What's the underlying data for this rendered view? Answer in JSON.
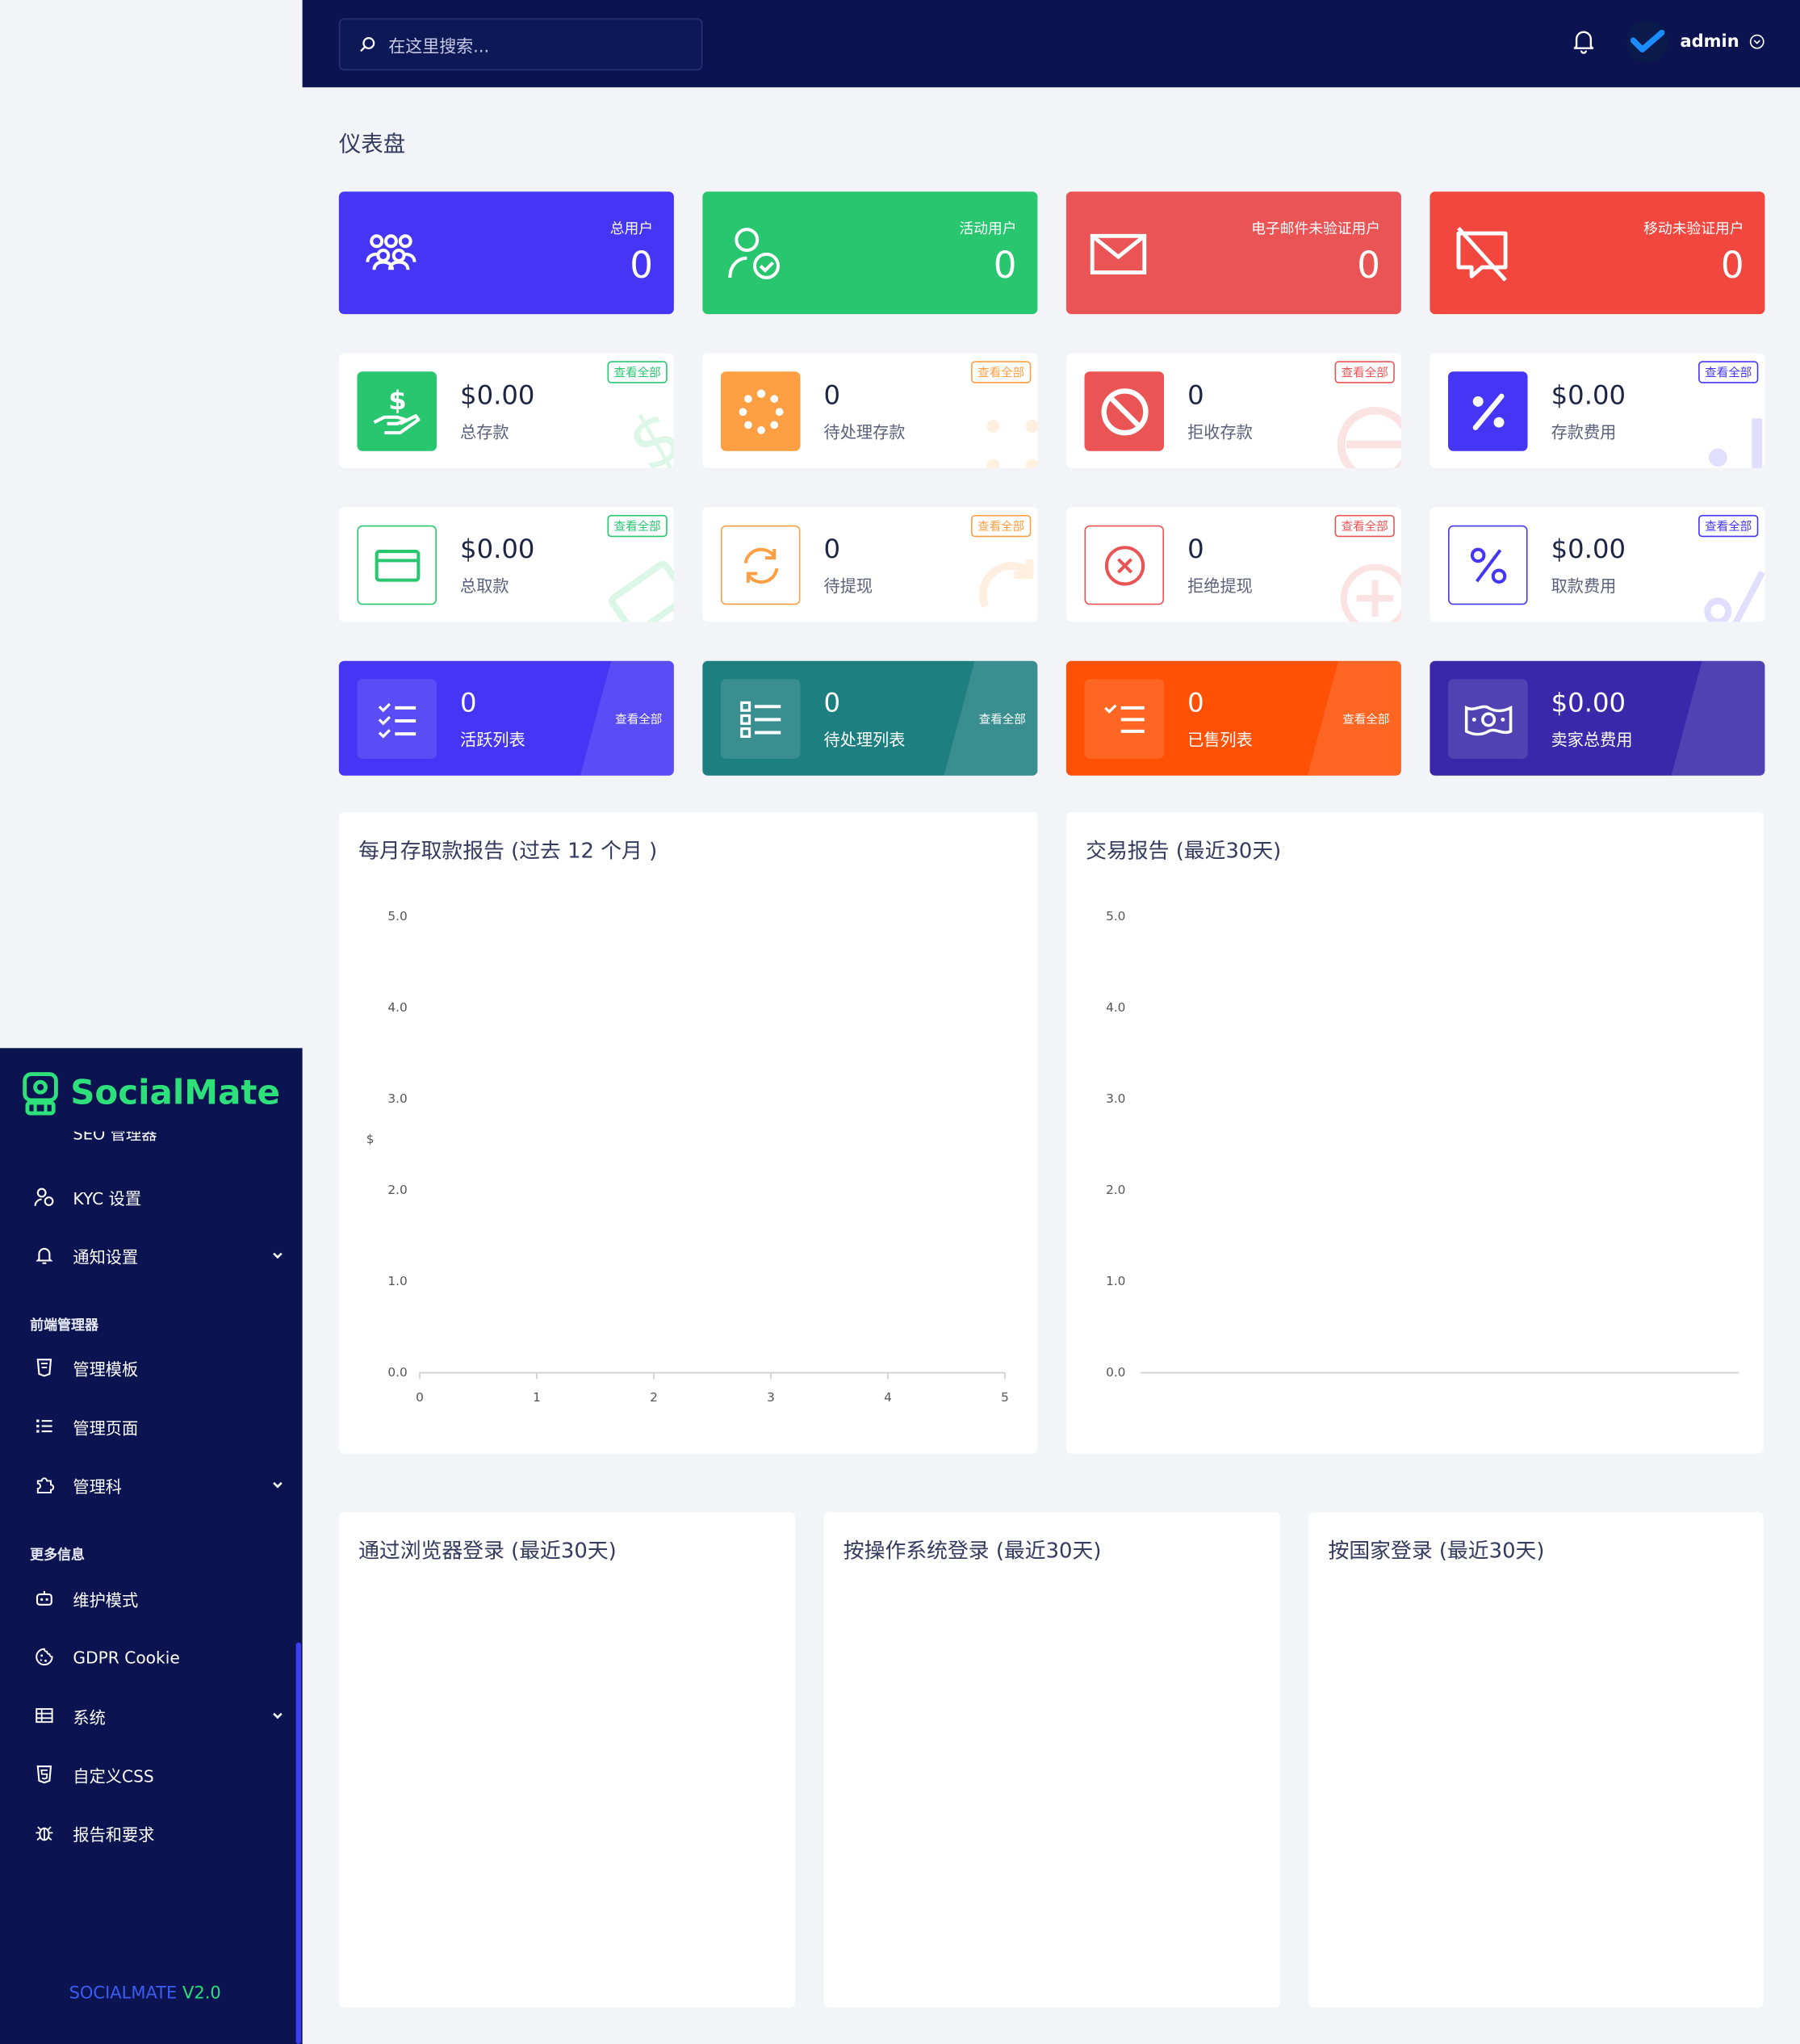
{
  "header": {
    "search_placeholder": "在这里搜索...",
    "user_name": "admin"
  },
  "sidebar": {
    "brand": "SocialMate",
    "cut_item": "SEO 管理器",
    "items_top": [
      {
        "label": "KYC 设置",
        "icon": "user-check-icon"
      },
      {
        "label": "通知设置",
        "icon": "bell-icon",
        "has_submenu": true
      }
    ],
    "section_frontend": "前端管理器",
    "items_frontend": [
      {
        "label": "管理模板",
        "icon": "template-icon"
      },
      {
        "label": "管理页面",
        "icon": "list-icon"
      },
      {
        "label": "管理科",
        "icon": "puzzle-icon",
        "has_submenu": true
      }
    ],
    "section_more": "更多信息",
    "items_more": [
      {
        "label": "维护模式",
        "icon": "robot-icon"
      },
      {
        "label": "GDPR Cookie",
        "icon": "cookie-icon"
      },
      {
        "label": "系统",
        "icon": "server-icon",
        "has_submenu": true
      },
      {
        "label": "自定义CSS",
        "icon": "css-icon"
      },
      {
        "label": "报告和要求",
        "icon": "bug-icon"
      }
    ],
    "version_name": "SOCIALMATE",
    "version_number": "V2.0"
  },
  "page_title": "仪表盘",
  "stats": [
    {
      "label": "总用户",
      "value": "0",
      "color": "#4535f5",
      "icon": "users-icon"
    },
    {
      "label": "活动用户",
      "value": "0",
      "color": "#28c66f",
      "icon": "user-active-icon"
    },
    {
      "label": "电子邮件未验证用户",
      "value": "0",
      "color": "#ea5455",
      "icon": "envelope-icon"
    },
    {
      "label": "移动未验证用户",
      "value": "0",
      "color": "#f2473f",
      "icon": "mobile-off-icon"
    }
  ],
  "view_all": "查看全部",
  "deposits": [
    {
      "value": "$0.00",
      "label": "总存款",
      "color": "#28c66f",
      "icon": "hand-dollar-icon"
    },
    {
      "value": "0",
      "label": "待处理存款",
      "color": "#ff9f43",
      "icon": "spinner-icon"
    },
    {
      "value": "0",
      "label": "拒收存款",
      "color": "#ea5455",
      "icon": "ban-icon"
    },
    {
      "value": "$0.00",
      "label": "存款费用",
      "color": "#4535f5",
      "icon": "percent-icon"
    }
  ],
  "withdrawals": [
    {
      "value": "$0.00",
      "label": "总取款",
      "color": "#28c66f",
      "icon": "credit-card-icon"
    },
    {
      "value": "0",
      "label": "待提现",
      "color": "#ff9f43",
      "icon": "sync-icon"
    },
    {
      "value": "0",
      "label": "拒绝提现",
      "color": "#ea5455",
      "icon": "times-circle-icon"
    },
    {
      "value": "$0.00",
      "label": "取款费用",
      "color": "#4535f5",
      "icon": "percent-icon"
    }
  ],
  "listings": [
    {
      "value": "0",
      "label": "活跃列表",
      "color": "#4535f5",
      "icon": "checklist-icon",
      "has_view_all": true
    },
    {
      "value": "0",
      "label": "待处理列表",
      "color": "#1e7f80",
      "icon": "list-ul-icon",
      "has_view_all": true
    },
    {
      "value": "0",
      "label": "已售列表",
      "color": "#ff5106",
      "icon": "list-check-icon",
      "has_view_all": true
    },
    {
      "value": "$0.00",
      "label": "卖家总费用",
      "color": "#3a28aa",
      "icon": "money-icon",
      "has_view_all": false
    }
  ],
  "charts": {
    "monthly_title": "每月存取款报告 (过去 12 个月 )",
    "transaction_title": "交易报告 (最近30天)",
    "browser_title": "通过浏览器登录 (最近30天)",
    "os_title": "按操作系统登录 (最近30天)",
    "country_title": "按国家登录 (最近30天)",
    "dollar_label": "$"
  },
  "chart_data": [
    {
      "type": "line",
      "title": "每月存取款报告 (过去 12 个月 )",
      "x": [
        0,
        1,
        2,
        3,
        4,
        5
      ],
      "series": [],
      "xlim": [
        0,
        5
      ],
      "ylim": [
        0,
        5
      ],
      "yticks": [
        "0.0",
        "1.0",
        "2.0",
        "3.0",
        "4.0",
        "5.0"
      ],
      "xticks": [
        "0",
        "1",
        "2",
        "3",
        "4",
        "5"
      ],
      "ylabel": "$",
      "grid": false
    },
    {
      "type": "line",
      "title": "交易报告 (最近30天)",
      "series": [],
      "ylim": [
        0,
        5
      ],
      "yticks": [
        "0.0",
        "1.0",
        "2.0",
        "3.0",
        "4.0",
        "5.0"
      ],
      "xticks": [],
      "grid": false
    }
  ]
}
